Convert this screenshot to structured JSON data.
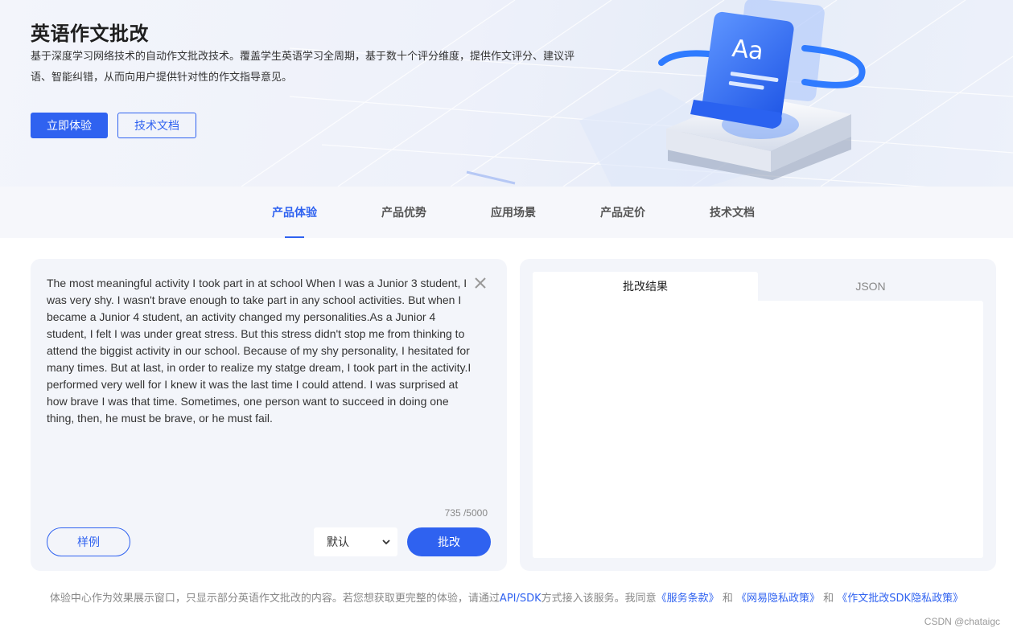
{
  "hero": {
    "title": "英语作文批改",
    "description": "基于深度学习网络技术的自动作文批改技术。覆盖学生英语学习全周期，基于数十个评分维度，提供作文评分、建议评语、智能纠错，从而向用户提供针对性的作文指导意见。",
    "primary_button": "立即体验",
    "secondary_button": "技术文档",
    "illustration_text": "Aa"
  },
  "nav": {
    "tabs": [
      {
        "label": "产品体验",
        "active": true
      },
      {
        "label": "产品优势",
        "active": false
      },
      {
        "label": "应用场景",
        "active": false
      },
      {
        "label": "产品定价",
        "active": false
      },
      {
        "label": "技术文档",
        "active": false
      }
    ]
  },
  "editor": {
    "essay_text": "The most meaningful activity I took part in at school When I was a Junior 3 student, I was very shy. I wasn't brave enough to take part in any school activities. But when I became a Junior 4 student, an activity changed my personalities.As a Junior 4 student, I felt I was under great stress. But this stress didn't stop me from thinking to attend the biggist activity in our school. Because of my shy personality, I hesitated for many times. But at last, in order to realize my statge dream, I took part in the activity.I performed very well for I knew it was the last time I could attend. I was surprised at how brave I was that time. Sometimes, one person want to succeed in doing one thing, then, he must be brave, or he must fail.",
    "char_count": "735 /5000",
    "sample_button": "样例",
    "mode_select": "默认",
    "submit_button": "批改"
  },
  "result": {
    "tabs": [
      {
        "label": "批改结果",
        "active": true
      },
      {
        "label": "JSON",
        "active": false
      }
    ]
  },
  "footer": {
    "note_prefix": "体验中心作为效果展示窗口，只显示部分英语作文批改的内容。若您想获取更完整的体验，请通过",
    "api_link": "API/SDK",
    "note_middle": "方式接入该服务。我同意",
    "terms_link": "《服务条款》",
    "and1": "和",
    "privacy_link": "《网易隐私政策》",
    "and2": "和",
    "sdk_privacy_link": "《作文批改SDK隐私政策》",
    "watermark": "CSDN @chataigc"
  },
  "colors": {
    "accent": "#2f62f0",
    "panel_bg": "#f3f5fa",
    "tabbar_bg": "#f6f7fb"
  }
}
